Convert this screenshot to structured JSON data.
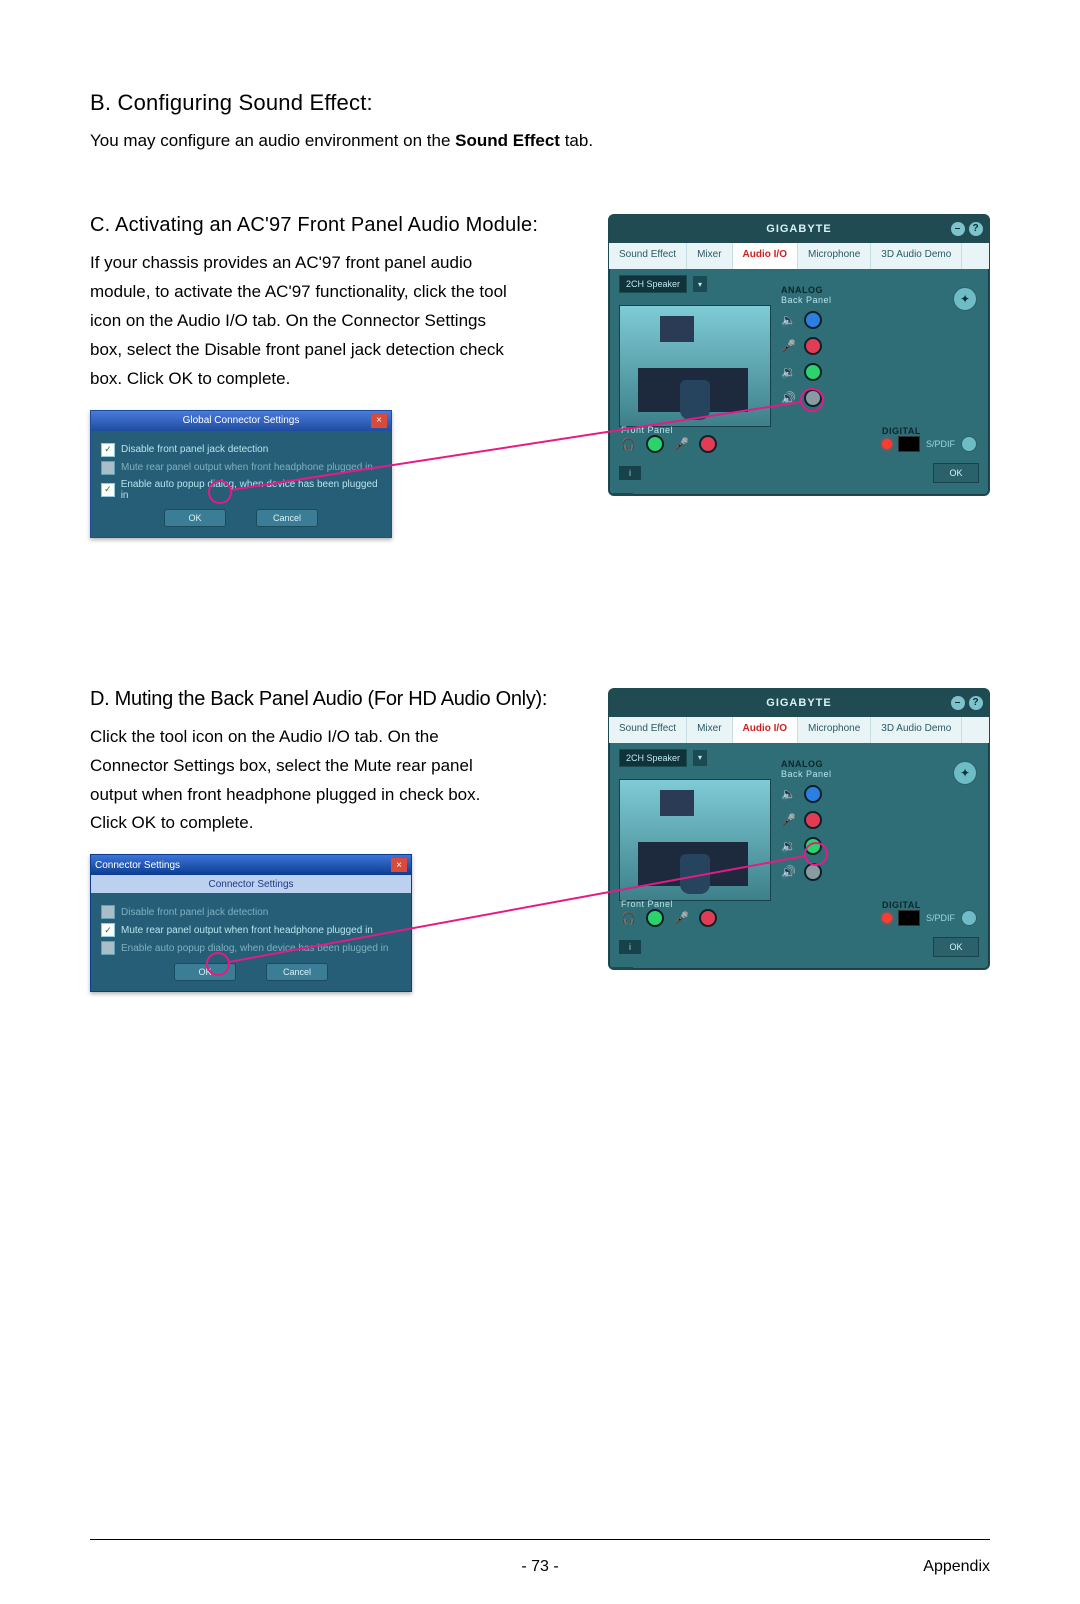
{
  "sectionB": {
    "title": "B. Configuring Sound Effect:",
    "body_pre": "You may configure an audio environment on the ",
    "body_bold": "Sound Effect",
    "body_post": " tab."
  },
  "sectionC": {
    "title": "C. Activating an AC'97 Front Panel Audio Module:",
    "body": "If your chassis provides an AC'97 front panel audio module, to activate the AC'97 functionality, click the tool icon on the Audio I/O tab. On the Connector Settings box, select the Disable front panel jack detection check box. Click OK to complete."
  },
  "sectionD": {
    "title": "D. Muting the Back Panel Audio (For HD Audio Only):",
    "body": "Click the tool icon on the Audio I/O tab. On the Connector Settings box, select the Mute rear panel output when front headphone plugged in check box. Click OK to complete."
  },
  "audioPanel": {
    "brand": "GIGABYTE",
    "tabs": [
      "Sound Effect",
      "Mixer",
      "Audio I/O",
      "Microphone",
      "3D Audio Demo"
    ],
    "activeTab": "Audio I/O",
    "speakerSel": "2CH Speaker",
    "analogLabel": "ANALOG",
    "backPanelLabel": "Back Panel",
    "frontPanelLabel": "Front Panel",
    "digitalLabel": "DIGITAL",
    "spdifLabel": "S/PDIF",
    "okLabel": "OK",
    "infoLabel": "i"
  },
  "gcs": {
    "title": "Global Connector Settings",
    "opt1": "Disable front panel jack detection",
    "opt2": "Mute rear panel output when front headphone plugged in",
    "opt3": "Enable auto popup dialog, when device has been plugged in",
    "ok": "OK",
    "cancel": "Cancel"
  },
  "cs": {
    "title": "Connector Settings",
    "subtitle": "Connector Settings"
  },
  "footer": {
    "page": "- 73 -",
    "section": "Appendix"
  }
}
